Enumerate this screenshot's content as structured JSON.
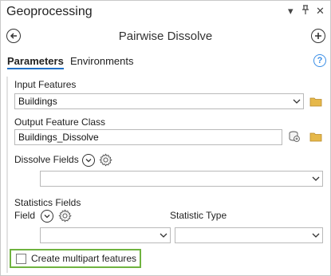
{
  "pane": {
    "title": "Geoprocessing"
  },
  "controls": {
    "dropdown": "▾",
    "pin": "ᵖ",
    "close": "✕"
  },
  "tool": {
    "title": "Pairwise Dissolve"
  },
  "tabs": {
    "parameters": "Parameters",
    "environments": "Environments"
  },
  "help": {
    "glyph": "?"
  },
  "params": {
    "input_features": {
      "label": "Input Features",
      "value": "Buildings"
    },
    "output_feature_class": {
      "label": "Output Feature Class",
      "value": "Buildings_Dissolve"
    },
    "dissolve_fields": {
      "label": "Dissolve Fields",
      "value": ""
    },
    "statistics_fields": {
      "label": "Statistics Fields",
      "field_label": "Field",
      "statistic_type_label": "Statistic Type",
      "field_value": "",
      "statistic_type_value": ""
    },
    "multipart": {
      "label": "Create multipart features",
      "checked": false
    }
  },
  "colors": {
    "highlight": "#6fb33f",
    "tab_underline": "#1f6fc5",
    "folder": "#e6b84a",
    "help": "#3a8ee6"
  },
  "icons": [
    "back-icon",
    "add-icon",
    "help-icon",
    "folder-icon",
    "output-database-icon",
    "chevron-down-icon",
    "gear-icon",
    "caret-down-icon"
  ]
}
